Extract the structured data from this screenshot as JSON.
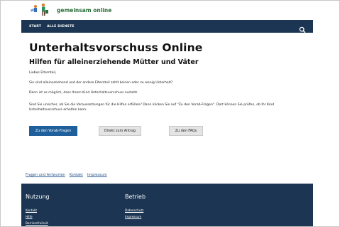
{
  "header": {
    "brand_name": "gemeinsam online",
    "nav": [
      {
        "label": "START"
      },
      {
        "label": "ALLE DIENSTE"
      }
    ]
  },
  "main": {
    "title": "Unterhaltsvorschuss Online",
    "subtitle": "Hilfen für alleinerziehende Mütter und Väter",
    "paragraphs": [
      "Liebes Elternteil,",
      "Sie sind alleinerziehend und der andere Elternteil zahlt keinen oder zu wenig Unterhalt?",
      "Dann ist es möglich, dass Ihrem Kind Unterhaltsvorschuss zusteht.",
      "Sind Sie unsicher, ob Sie die Voraussetzungen für die Hilfen erfüllen? Dann klicken Sie auf \"Zu den Vorab-Fragen\". Dort können Sie prüfen, ob Ihr Kind Unterhaltsvorschuss erhalten kann."
    ],
    "buttons": {
      "vorab": "Zu den Vorab-Fragen",
      "antrag": "Direkt zum Antrag",
      "faqs": "Zu den FAQs"
    }
  },
  "footer_links": [
    "Fragen und Antworten",
    "Kontakt",
    "Impressum"
  ],
  "footer": {
    "col1_title": "Nutzung",
    "col1_links": [
      "Kontakt",
      "Hilfe",
      "Barrierefreiheit"
    ],
    "col2_title": "Betrieb",
    "col2_links": [
      "Datenschutz",
      "Impressum"
    ]
  },
  "colors": {
    "nav_bg": "#1c3553",
    "brand": "#2a6f39",
    "primary_button": "#1f5f9b"
  }
}
